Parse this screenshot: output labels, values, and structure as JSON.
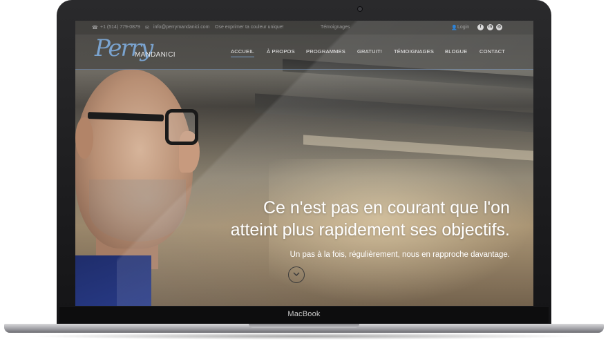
{
  "device": {
    "label": "MacBook"
  },
  "topbar": {
    "phone": "+1 (514) 779-0879",
    "email": "info@perrymandanici.com",
    "tagline": "Ose exprimer ta couleur unique!",
    "link": "Témoignages",
    "login": "Login",
    "social": [
      "facebook-icon",
      "linkedin-icon",
      "instagram-icon"
    ]
  },
  "header": {
    "logo_script": "Perry",
    "logo_name": "MANDANICI",
    "nav": [
      {
        "label": "ACCUEIL",
        "active": true
      },
      {
        "label": "À PROPOS"
      },
      {
        "label": "PROGRAMMES"
      },
      {
        "label": "GRATUIT!"
      },
      {
        "label": "TÉMOIGNAGES"
      },
      {
        "label": "BLOGUE"
      },
      {
        "label": "CONTACT"
      }
    ]
  },
  "hero": {
    "title": "Ce n'est pas en courant que l'on atteint plus rapidement ses objectifs.",
    "subtitle": "Un pas à la fois, régulièrement, nous en rapproche davantage."
  },
  "colors": {
    "accent": "#7aa3cf",
    "topbar_text": "#9a9a9a"
  }
}
